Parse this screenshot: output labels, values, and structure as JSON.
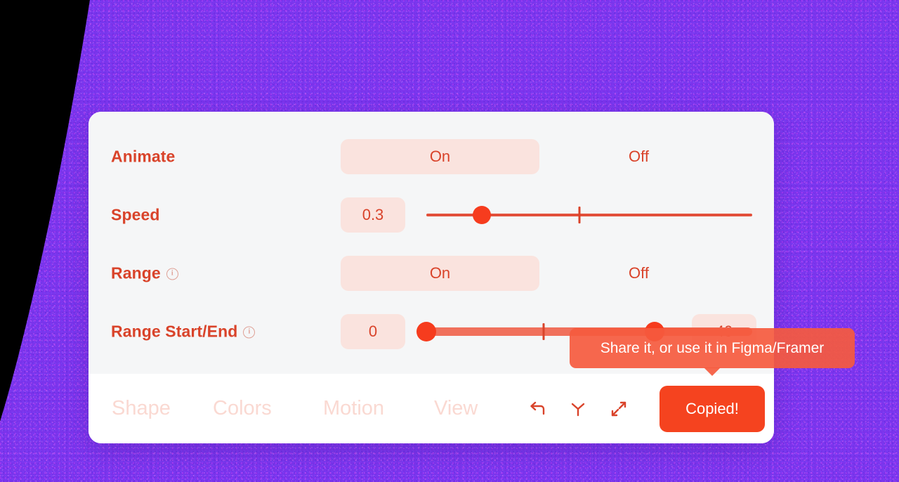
{
  "background": {
    "purple": "#7a32ef",
    "black": "#000000"
  },
  "theme": {
    "accent": "#d9432a",
    "accent_bright": "#f5431f",
    "chip_bg": "#fae3de",
    "card_bg": "#f5f6f7",
    "toolbar_bg": "#ffffff",
    "tab_inactive": "#fad9d2",
    "slider_track": "#e2503a",
    "slider_track_light": "#f0705c",
    "knob": "#f63c1e",
    "tooltip_bg": "#f55a3e"
  },
  "panel": {
    "rows": [
      {
        "label": "Animate",
        "has_info": false,
        "type": "segmented",
        "options": [
          "On",
          "Off"
        ],
        "selected": "On"
      },
      {
        "label": "Speed",
        "has_info": false,
        "type": "slider",
        "value": "0.3",
        "min": 0,
        "max": 1,
        "knob_pct": 17,
        "tick_pct": 47
      },
      {
        "label": "Range",
        "has_info": true,
        "info_glyph": "i",
        "type": "segmented",
        "options": [
          "On",
          "Off"
        ],
        "selected": "On"
      },
      {
        "label": "Range Start/End",
        "has_info": true,
        "info_glyph": "i",
        "type": "range-slider",
        "start_value": "0",
        "end_value": "40",
        "start_pct": 0,
        "end_pct": 70,
        "tick_pct": 36
      }
    ]
  },
  "toolbar": {
    "tabs": [
      {
        "label": "Shape",
        "active": false
      },
      {
        "label": "Colors",
        "active": false
      },
      {
        "label": "Motion",
        "active": false
      },
      {
        "label": "View",
        "active": false
      }
    ],
    "icons": [
      {
        "name": "undo-icon",
        "title": "Undo"
      },
      {
        "name": "randomize-icon",
        "title": "Randomize"
      },
      {
        "name": "collapse-icon",
        "title": "Collapse"
      }
    ],
    "primary_button": "Copied!"
  },
  "tooltip": {
    "text": "Share it, or use it in Figma/Framer"
  }
}
